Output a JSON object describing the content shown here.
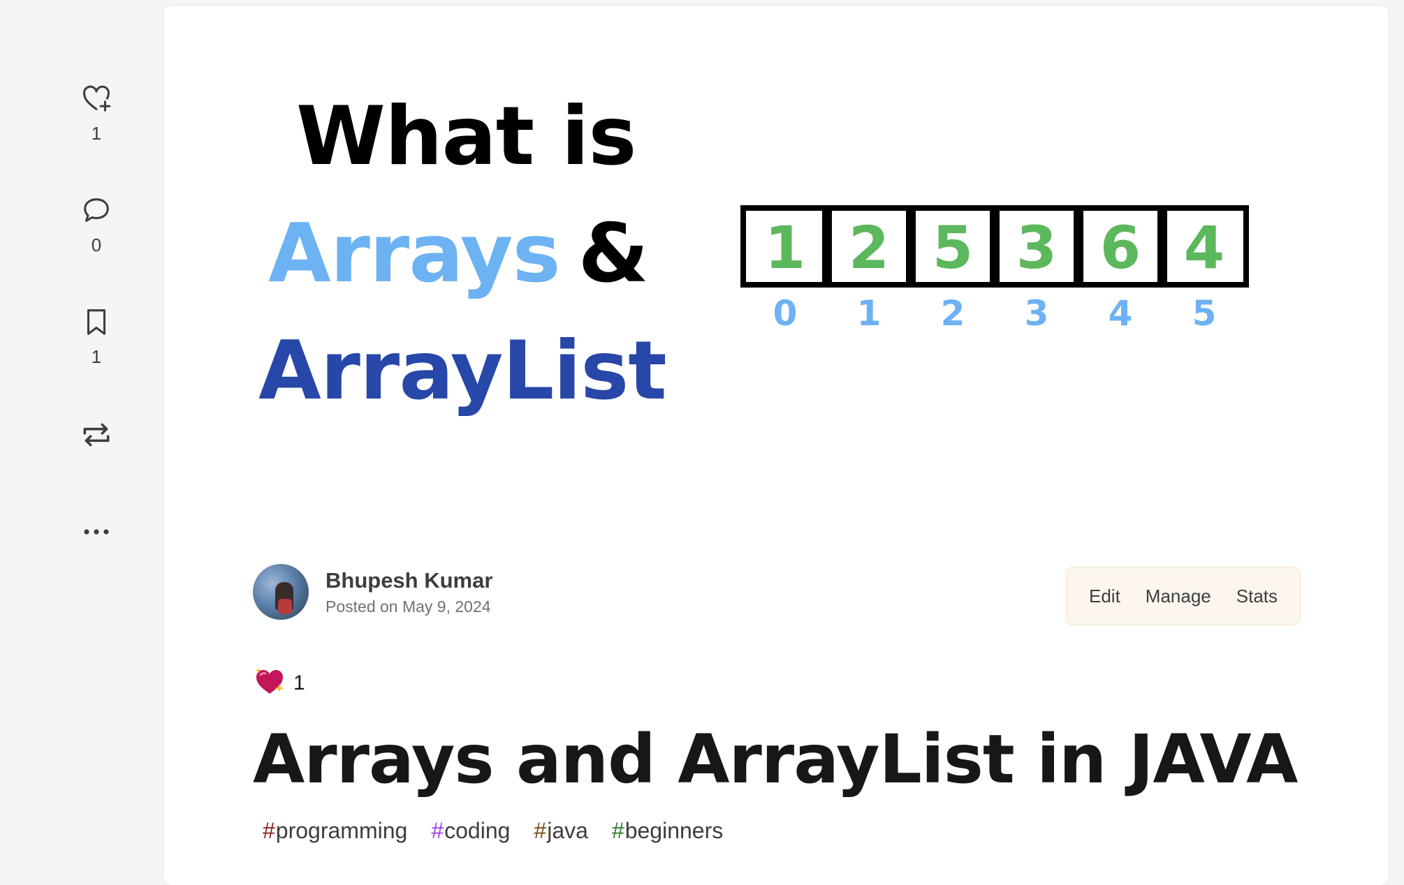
{
  "sidebar": {
    "reactions": {
      "icon": "heart-plus-icon",
      "count": "1"
    },
    "comments": {
      "icon": "comment-icon",
      "count": "0"
    },
    "bookmarks": {
      "icon": "bookmark-icon",
      "count": "1"
    },
    "share": {
      "icon": "repost-icon"
    },
    "more": {
      "icon": "more-horizontal-icon"
    }
  },
  "cover": {
    "line1": "What is",
    "line2_word": "Arrays",
    "line2_amp": "&",
    "line3": "ArrayList",
    "array_values": [
      "1",
      "2",
      "5",
      "3",
      "6",
      "4"
    ],
    "array_indices": [
      "0",
      "1",
      "2",
      "3",
      "4",
      "5"
    ],
    "colors": {
      "value_green": "#5cb85c",
      "index_blue": "#6db2f2",
      "dark_blue": "#2747a9",
      "light_blue": "#6db2f2"
    }
  },
  "author": {
    "name": "Bhupesh Kumar",
    "posted": "Posted on May 9, 2024"
  },
  "actions": {
    "edit": "Edit",
    "manage": "Manage",
    "stats": "Stats"
  },
  "reactions": {
    "icon": "sparkle-heart-icon",
    "count": "1"
  },
  "post": {
    "title": "Arrays and ArrayList in JAVA"
  },
  "tags": [
    {
      "name": "programming",
      "hash_color": "#8b1b1b"
    },
    {
      "name": "coding",
      "hash_color": "#9b40e8"
    },
    {
      "name": "java",
      "hash_color": "#7a4a17"
    },
    {
      "name": "beginners",
      "hash_color": "#2f7a2f"
    }
  ]
}
